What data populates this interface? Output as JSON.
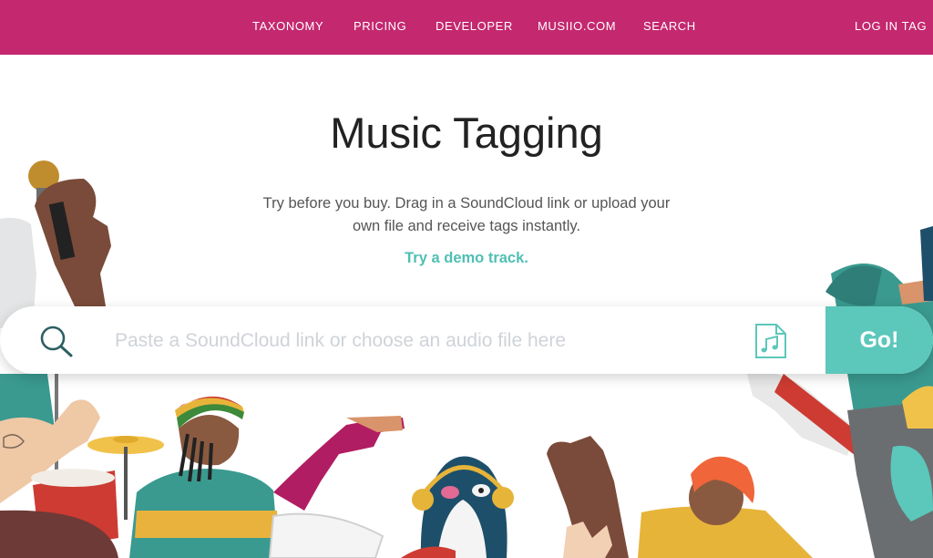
{
  "nav": {
    "items": [
      "TAXONOMY",
      "PRICING",
      "DEVELOPER",
      "MUSIIO.COM",
      "SEARCH"
    ],
    "login": "LOG IN TAG"
  },
  "hero": {
    "title": "Music Tagging",
    "subtitle_line1": "Try before you buy. Drag in a SoundCloud link or upload your",
    "subtitle_line2": "own file and receive tags instantly.",
    "demo_link": "Try a demo track."
  },
  "search": {
    "placeholder": "Paste a SoundCloud link or choose an audio file here",
    "value": "",
    "go_label": "Go!"
  },
  "icons": {
    "search": "search-icon",
    "file": "music-file-icon"
  },
  "colors": {
    "nav_background": "#c4286f",
    "accent_teal": "#5cc7bb",
    "title_text": "#222222",
    "body_text": "#555555"
  }
}
